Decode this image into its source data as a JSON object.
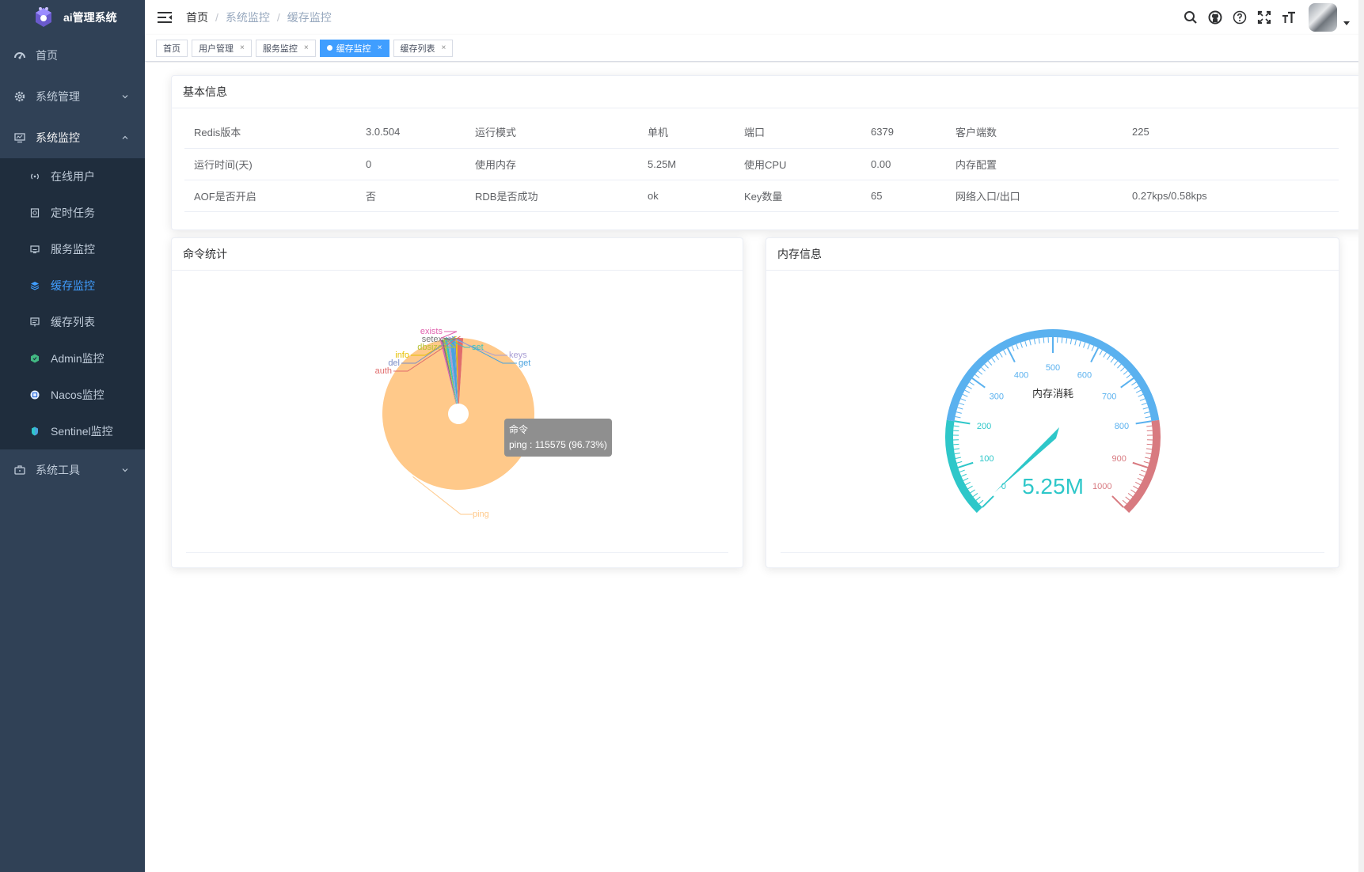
{
  "app": {
    "title": "ai管理系统"
  },
  "sidebar": {
    "items": [
      {
        "label": "首页",
        "icon": "dashboard-icon"
      },
      {
        "label": "系统管理",
        "icon": "gear-icon",
        "expanded": false
      },
      {
        "label": "系统监控",
        "icon": "monitor-icon",
        "expanded": true,
        "children": [
          {
            "label": "在线用户",
            "icon": "online-icon"
          },
          {
            "label": "定时任务",
            "icon": "job-icon"
          },
          {
            "label": "服务监控",
            "icon": "server-icon"
          },
          {
            "label": "缓存监控",
            "icon": "redis-icon",
            "active": true
          },
          {
            "label": "缓存列表",
            "icon": "list-icon"
          },
          {
            "label": "Admin监控",
            "icon": "admin-icon"
          },
          {
            "label": "Nacos监控",
            "icon": "nacos-icon"
          },
          {
            "label": "Sentinel监控",
            "icon": "sentinel-icon"
          }
        ]
      },
      {
        "label": "系统工具",
        "icon": "toolbox-icon",
        "expanded": false
      }
    ]
  },
  "breadcrumb": [
    "首页",
    "系统监控",
    "缓存监控"
  ],
  "tags": [
    {
      "label": "首页",
      "closable": false
    },
    {
      "label": "用户管理",
      "closable": true
    },
    {
      "label": "服务监控",
      "closable": true
    },
    {
      "label": "缓存监控",
      "closable": true,
      "active": true
    },
    {
      "label": "缓存列表",
      "closable": true
    }
  ],
  "basic_info": {
    "title": "基本信息",
    "rows": [
      [
        "Redis版本",
        "3.0.504",
        "运行模式",
        "单机",
        "端口",
        "6379",
        "客户端数",
        "225"
      ],
      [
        "运行时间(天)",
        "0",
        "使用内存",
        "5.25M",
        "使用CPU",
        "0.00",
        "内存配置",
        ""
      ],
      [
        "AOF是否开启",
        "否",
        "RDB是否成功",
        "ok",
        "Key数量",
        "65",
        "网络入口/出口",
        "0.27kps/0.58kps"
      ]
    ]
  },
  "command_stats": {
    "title": "命令统计"
  },
  "memory_info": {
    "title": "内存信息"
  },
  "tooltip": {
    "title": "命令",
    "text": "ping : 115575 (96.73%)"
  },
  "colors": {
    "accent": "#409eff",
    "sidebar_bg": "#304156",
    "submenu_bg": "#1f2d3d"
  },
  "chart_data": [
    {
      "type": "pie",
      "name": "命令",
      "labels": [
        "ping",
        "get",
        "keys",
        "set",
        "dbsize",
        "setex",
        "exists",
        "info",
        "del",
        "auth"
      ],
      "values": [
        115575,
        1200,
        620,
        620,
        420,
        420,
        420,
        420,
        320,
        1500
      ],
      "percent_ping": 96.73,
      "colors": [
        "#ffc98a",
        "#4aa3df",
        "#a99ed4",
        "#36c3c3",
        "#b5c334",
        "#777777",
        "#e062ae",
        "#e6c000",
        "#7b8ec6",
        "#e06c6c"
      ]
    },
    {
      "type": "gauge",
      "title": "内存消耗",
      "value": 5.25,
      "value_label": "5.25M",
      "min": 0,
      "max": 1000,
      "ticks": [
        0,
        100,
        200,
        300,
        400,
        500,
        600,
        700,
        800,
        900,
        1000
      ],
      "bands": [
        {
          "to": 0.2,
          "color": "#2ec7c9"
        },
        {
          "to": 0.8,
          "color": "#5ab1ef"
        },
        {
          "to": 1.0,
          "color": "#d87a80"
        }
      ]
    }
  ]
}
